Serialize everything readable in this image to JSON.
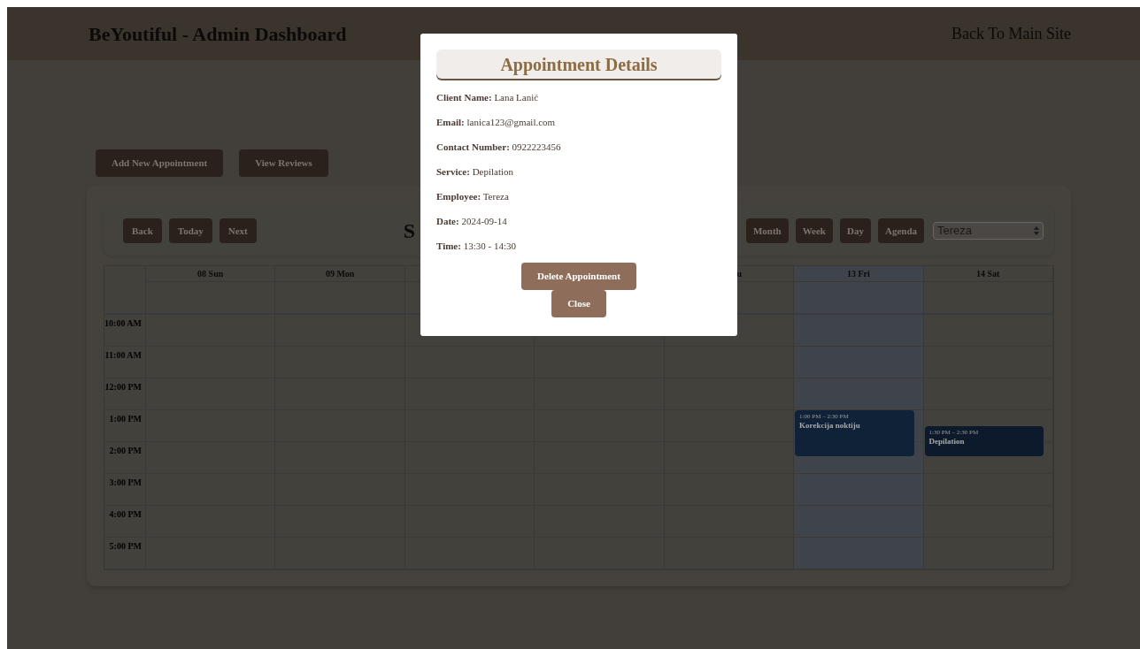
{
  "header": {
    "title": "BeYoutiful - Admin Dashboard",
    "back_link": "Back To Main Site"
  },
  "actions": [
    "Add New Appointment",
    "View Reviews"
  ],
  "calendar": {
    "nav": [
      "Back",
      "Today",
      "Next"
    ],
    "title": "S",
    "views": [
      "Month",
      "Week",
      "Day",
      "Agenda"
    ],
    "employee_select": "Tereza",
    "days": [
      {
        "label": "08 Sun",
        "today": false
      },
      {
        "label": "09 Mon",
        "today": false
      },
      {
        "today": false
      },
      {
        "today": false
      },
      {
        "label": "u",
        "kind": "cut",
        "today": false
      },
      {
        "label": "13 Fri",
        "today": true
      },
      {
        "label": "14 Sat",
        "today": false
      }
    ],
    "times": [
      "10:00 AM",
      "11:00 AM",
      "12:00 PM",
      "1:00 PM",
      "2:00 PM",
      "3:00 PM",
      "4:00 PM",
      "5:00 PM"
    ],
    "events": [
      {
        "time": "1:00 PM – 2:30 PM",
        "title": "Korekcija noktiju",
        "color": "#0f2238"
      },
      {
        "time": "1:30 PM – 2:30 PM",
        "title": "Depilation",
        "color": "#0c1a2b"
      }
    ]
  },
  "modal": {
    "title": "Appointment Details",
    "fields": [
      "**Client Name:** Lana Lanić",
      "**Email:** lanica123@gmail.com",
      "**Contact Number:** 0922223456",
      "**Service:** Depilation",
      "**Employee:** Tereza",
      "**Date:** 2024-09-14",
      "**Time:** 13:30 - 14:30"
    ],
    "buttons": [
      "Delete Appointment",
      "Close"
    ]
  }
}
